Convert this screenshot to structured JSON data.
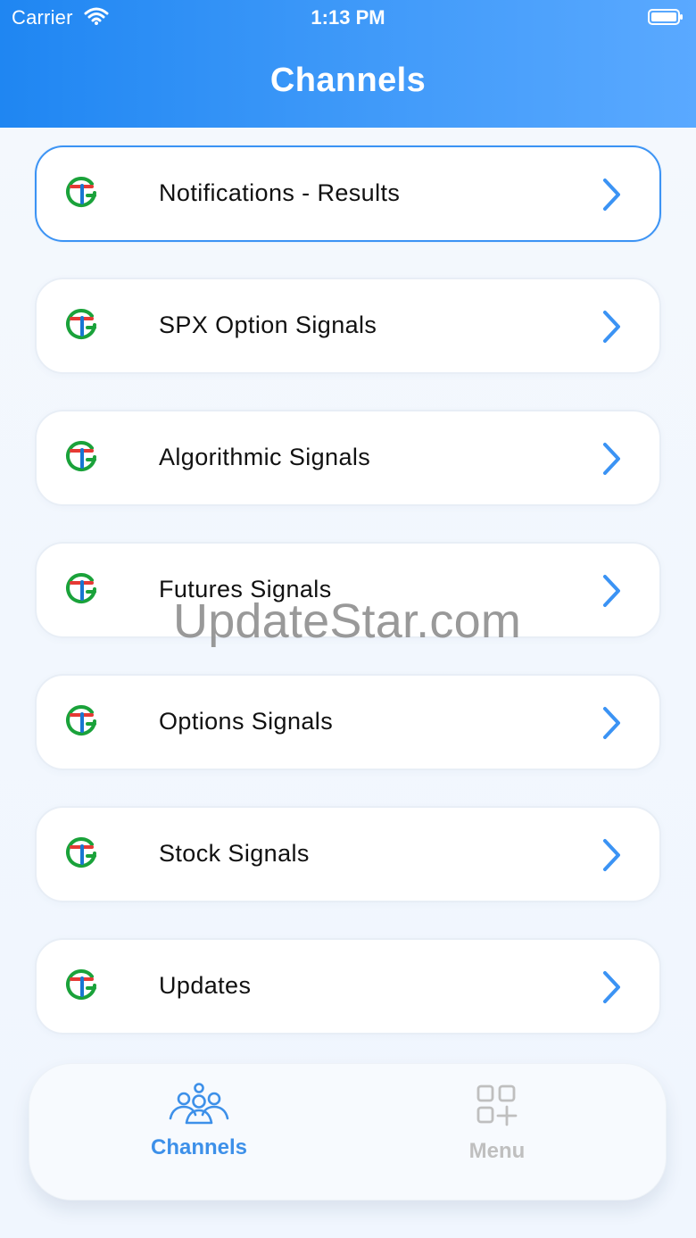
{
  "status_bar": {
    "carrier": "Carrier",
    "time": "1:13 PM",
    "wifi_icon": "wifi-icon",
    "battery_icon": "battery-icon"
  },
  "header": {
    "title": "Channels",
    "gradient_colors": [
      "#1f86f2",
      "#5aa9ff"
    ]
  },
  "channels": [
    {
      "label": "Notifications - Results",
      "icon": "signal-logo-icon",
      "selected": true
    },
    {
      "label": "SPX Option Signals",
      "icon": "signal-logo-icon",
      "selected": false
    },
    {
      "label": "Algorithmic Signals",
      "icon": "signal-logo-icon",
      "selected": false
    },
    {
      "label": "Futures Signals",
      "icon": "signal-logo-icon",
      "selected": false
    },
    {
      "label": "Options Signals",
      "icon": "signal-logo-icon",
      "selected": false
    },
    {
      "label": "Stock Signals",
      "icon": "signal-logo-icon",
      "selected": false
    },
    {
      "label": "Updates",
      "icon": "signal-logo-icon",
      "selected": false
    }
  ],
  "watermark": "UpdateStar.com",
  "tab_bar": {
    "channels": {
      "label": "Channels",
      "icon": "group-users-icon",
      "active": true
    },
    "menu": {
      "label": "Menu",
      "icon": "grid-add-icon",
      "active": false
    }
  },
  "colors": {
    "accent": "#3b93f4",
    "icon_green": "#1aa23a",
    "icon_red": "#e53935",
    "icon_blue": "#1976d2",
    "inactive_gray": "#bfbfbf"
  }
}
